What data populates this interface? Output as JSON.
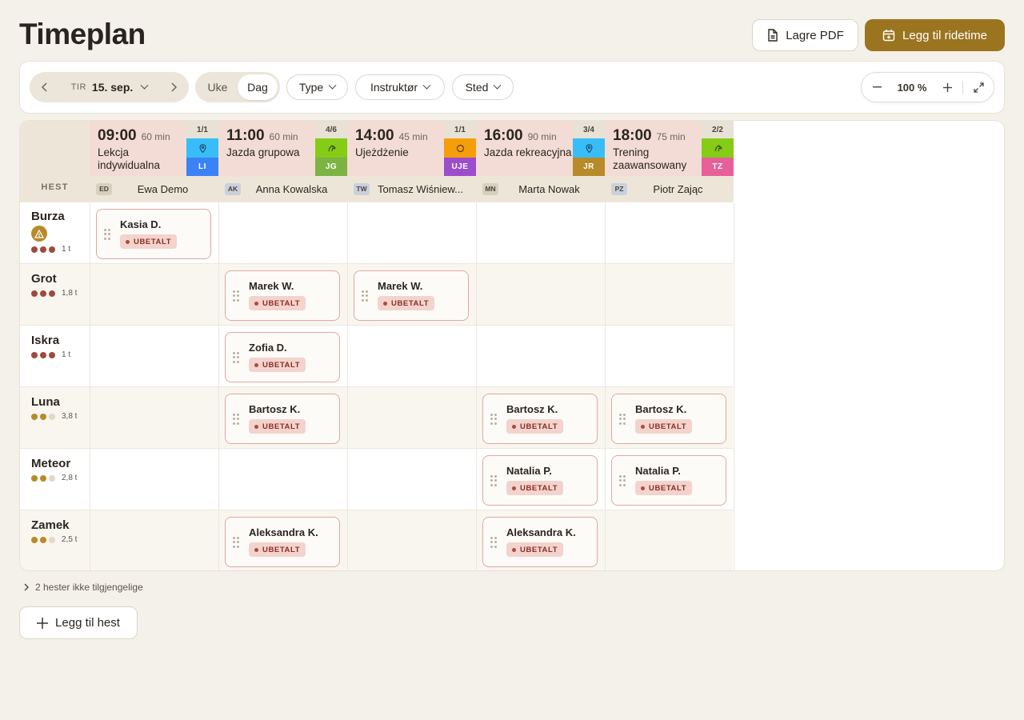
{
  "page": {
    "title": "Timeplan"
  },
  "actions": {
    "pdf_label": "Lagre PDF",
    "add_lesson_label": "Legg til ridetime",
    "add_horse_label": "Legg til hest"
  },
  "toolbar": {
    "day_abbr": "TIR",
    "date": "15. sep.",
    "view_week": "Uke",
    "view_day": "Dag",
    "active_view": "Dag",
    "filters": [
      "Type",
      "Instruktør",
      "Sted"
    ],
    "zoom": "100 %"
  },
  "grid": {
    "horse_header": "HEST",
    "lessons": [
      {
        "time": "09:00",
        "duration": "60 min",
        "title": "Lekcja indywidualna",
        "count": "1/1",
        "icon": "location-pin-icon",
        "icon_bg": "#38bdf8",
        "code": "LI",
        "code_bg": "#3b82f6",
        "instr_initials": "ED",
        "instructor": "Ewa Demo"
      },
      {
        "time": "11:00",
        "duration": "60 min",
        "title": "Jazda grupowa",
        "count": "4/6",
        "icon": "horse-icon",
        "icon_bg": "#84cc16",
        "code": "JG",
        "code_bg": "#7cb342",
        "instr_initials": "AK",
        "instructor": "Anna Kowalska"
      },
      {
        "time": "14:00",
        "duration": "45 min",
        "title": "Ujeżdżenie",
        "count": "1/1",
        "icon": "circle-icon",
        "icon_bg": "#f59e0b",
        "code": "UJE",
        "code_bg": "#9c4dcc",
        "instr_initials": "TW",
        "instructor": "Tomasz Wiśniew..."
      },
      {
        "time": "16:00",
        "duration": "90 min",
        "title": "Jazda rekreacyjna",
        "count": "3/4",
        "icon": "location-pin-icon",
        "icon_bg": "#38bdf8",
        "code": "JR",
        "code_bg": "#b88a2a",
        "instr_initials": "MN",
        "instructor": "Marta Nowak"
      },
      {
        "time": "18:00",
        "duration": "75 min",
        "title": "Trening zaawansowany",
        "count": "2/2",
        "icon": "horse-icon",
        "icon_bg": "#84cc16",
        "code": "TZ",
        "code_bg": "#e8609a",
        "instr_initials": "PZ",
        "instructor": "Piotr Zając"
      }
    ],
    "horses": [
      {
        "name": "Burza",
        "warning": true,
        "level": 3,
        "level_color": "#a04a3c",
        "hours": "1 t",
        "bookings": [
          {
            "col": 0,
            "rider": "Kasia D.",
            "status": "UBETALT"
          }
        ]
      },
      {
        "name": "Grot",
        "warning": false,
        "level": 3,
        "level_color": "#a04a3c",
        "hours": "1,8 t",
        "bookings": [
          {
            "col": 1,
            "rider": "Marek W.",
            "status": "UBETALT"
          },
          {
            "col": 2,
            "rider": "Marek W.",
            "status": "UBETALT"
          }
        ]
      },
      {
        "name": "Iskra",
        "warning": false,
        "level": 3,
        "level_color": "#a04a3c",
        "hours": "1 t",
        "bookings": [
          {
            "col": 1,
            "rider": "Zofia D.",
            "status": "UBETALT"
          }
        ]
      },
      {
        "name": "Luna",
        "warning": false,
        "level": 2,
        "level_color": "#b88a2a",
        "hours": "3,8 t",
        "bookings": [
          {
            "col": 1,
            "rider": "Bartosz K.",
            "status": "UBETALT"
          },
          {
            "col": 3,
            "rider": "Bartosz K.",
            "status": "UBETALT"
          },
          {
            "col": 4,
            "rider": "Bartosz K.",
            "status": "UBETALT"
          }
        ]
      },
      {
        "name": "Meteor",
        "warning": false,
        "level": 2,
        "level_color": "#b88a2a",
        "hours": "2,8 t",
        "bookings": [
          {
            "col": 3,
            "rider": "Natalia P.",
            "status": "UBETALT"
          },
          {
            "col": 4,
            "rider": "Natalia P.",
            "status": "UBETALT"
          }
        ]
      },
      {
        "name": "Zamek",
        "warning": false,
        "level": 2,
        "level_color": "#b88a2a",
        "hours": "2,5 t",
        "bookings": [
          {
            "col": 1,
            "rider": "Aleksandra K.",
            "status": "UBETALT"
          },
          {
            "col": 3,
            "rider": "Aleksandra K.",
            "status": "UBETALT"
          }
        ]
      }
    ]
  },
  "footer": {
    "unavailable_label": "2 hester ikke tilgjengelige"
  }
}
